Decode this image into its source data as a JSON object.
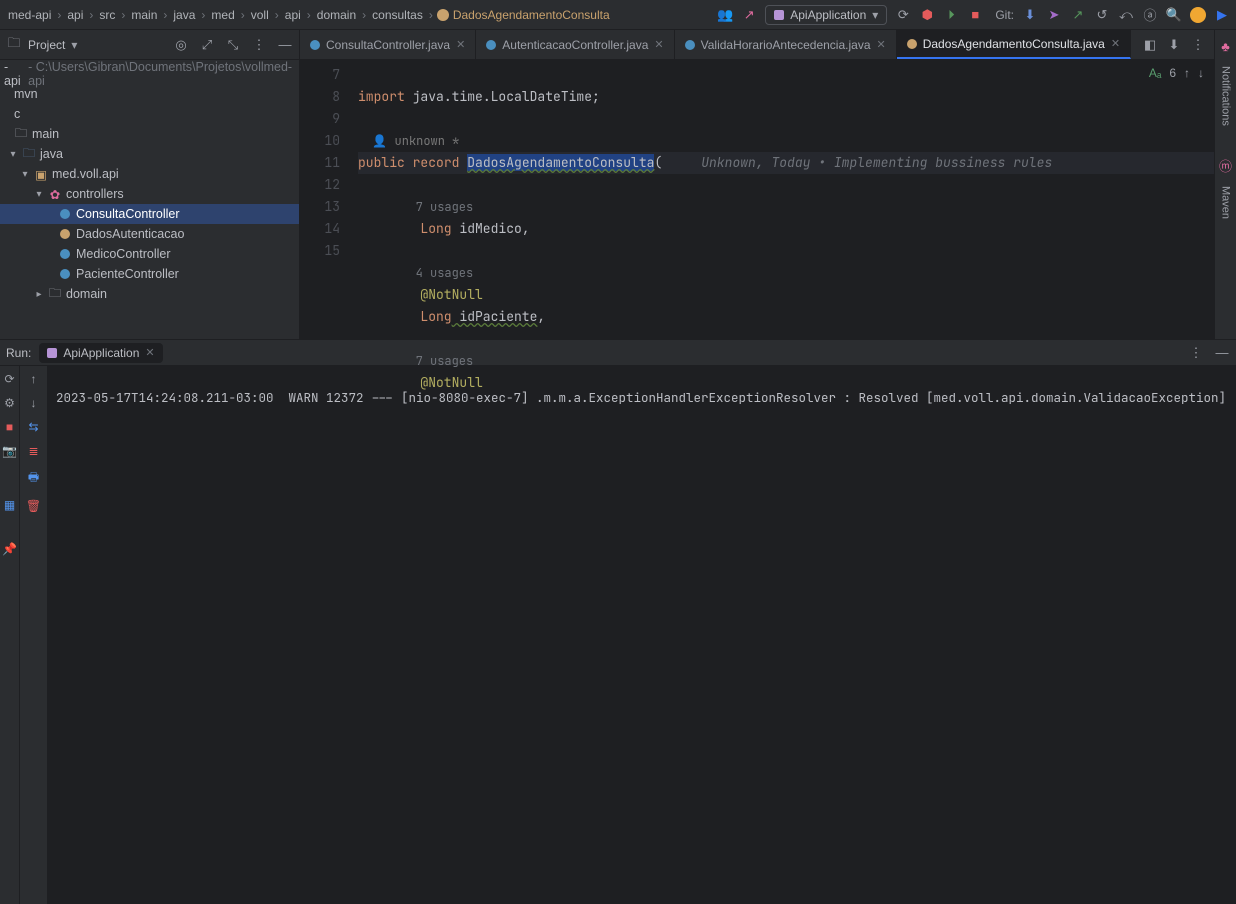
{
  "breadcrumb": [
    "med-api",
    "api",
    "src",
    "main",
    "java",
    "med",
    "voll",
    "api",
    "domain",
    "consultas"
  ],
  "breadcrumb_current": "DadosAgendamentoConsulta",
  "run_config": "ApiApplication",
  "git_label": "Git:",
  "project": {
    "title": "Project",
    "root_name": "-api",
    "root_path": " - C:\\Users\\Gibran\\Documents\\Projetos\\vollmed-api",
    "items": {
      "mvn": "mvn",
      "c": "c",
      "main": "main",
      "java": "java",
      "pkg": "med.voll.api",
      "controllers": "controllers",
      "c1": "ConsultaController",
      "c2": "DadosAutenticacao",
      "c3": "MedicoController",
      "c4": "PacienteController",
      "domain": "domain"
    }
  },
  "tabs": [
    {
      "label": "ConsultaController.java",
      "type": "class"
    },
    {
      "label": "AutenticacaoController.java",
      "type": "class"
    },
    {
      "label": "ValidaHorarioAntecedencia.java",
      "type": "class"
    },
    {
      "label": "DadosAgendamentoConsulta.java",
      "type": "record"
    }
  ],
  "problems_count": "6",
  "code": {
    "l7_import": "import",
    "l7_rest": " java.time.LocalDateTime;",
    "author_hint": "unknown *",
    "l9_pub": "public",
    "l9_rec": " record ",
    "l9_name": "DadosAgendamentoConsulta",
    "l9_paren": "(",
    "l9_inlay": "Unknown, Today • Implementing bussiness rules",
    "u7": "7 usages",
    "l10_type": "Long",
    "l10_id": " idMedico",
    "l10_comma": ",",
    "u4": "4 usages",
    "ann": "@NotNull",
    "l13_type": "Long",
    "l13_id": " idPaciente",
    "l13_comma": ",",
    "u7b": "7 usages",
    "ann2": "@NotNull"
  },
  "line_numbers": [
    "7",
    "8",
    "",
    "9",
    "",
    "10",
    "11",
    "",
    "12",
    "13",
    "14",
    "",
    "15"
  ],
  "run": {
    "label": "Run:",
    "tab": "ApiApplication",
    "log": "2023-05-17T14:24:08.211-03:00  WARN 12372 --- [nio-8080-exec-7] .m.m.a.ExceptionHandlerExceptionResolver : Resolved [med.voll.api.domain.ValidacaoException]"
  },
  "right_labels": {
    "notif": "Notifications",
    "maven": "Maven"
  }
}
